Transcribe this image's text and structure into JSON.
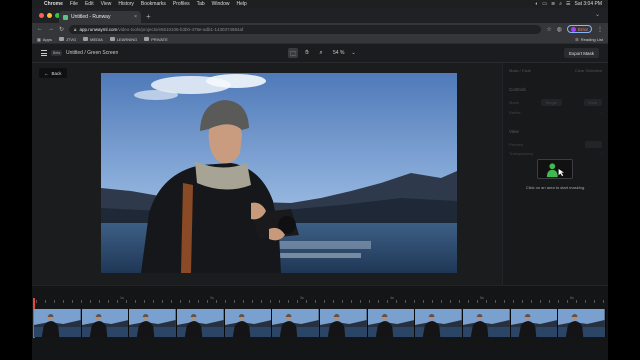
{
  "menubar": {
    "app": "Chrome",
    "items": [
      "File",
      "Edit",
      "View",
      "History",
      "Bookmarks",
      "Profiles",
      "Tab",
      "Window",
      "Help"
    ],
    "datetime": "Sat 3:04 PM"
  },
  "browser": {
    "tab_title": "Untitled - Runway",
    "url_host": "app.runwayml.com",
    "url_path": "/video-tools/projects/e5610106-b3b0-478e-adb1-1430374884af",
    "error_label": "Error",
    "bookmarks": [
      "Apps",
      "JTVG",
      "MEDIA",
      "LEARNING",
      "PRIVATE"
    ],
    "reading_list": "Reading List"
  },
  "app": {
    "beta_badge": "Beta",
    "breadcrumb": "Untitled / Green Screen",
    "zoom": "54 %",
    "export_label": "Export Mask",
    "back_label": "Back"
  },
  "panel": {
    "top_left": "Mask / Fade",
    "top_right": "Clear Selection",
    "section1": "Controls",
    "row1_label": "Mode",
    "row1_opt1": "Single",
    "row1_opt2": "Multi",
    "row2_label": "Refine",
    "section2": "View",
    "row3_label": "Preview",
    "row4_label": "Transparency",
    "hint": "Click on an area to start masking."
  },
  "timeline": {
    "labels": [
      "1s",
      "2s",
      "3s",
      "4s",
      "5s",
      "6s"
    ]
  },
  "colors": {
    "accent_green": "#3fb950",
    "playhead": "#e2483d",
    "error_text": "#f28b82"
  }
}
